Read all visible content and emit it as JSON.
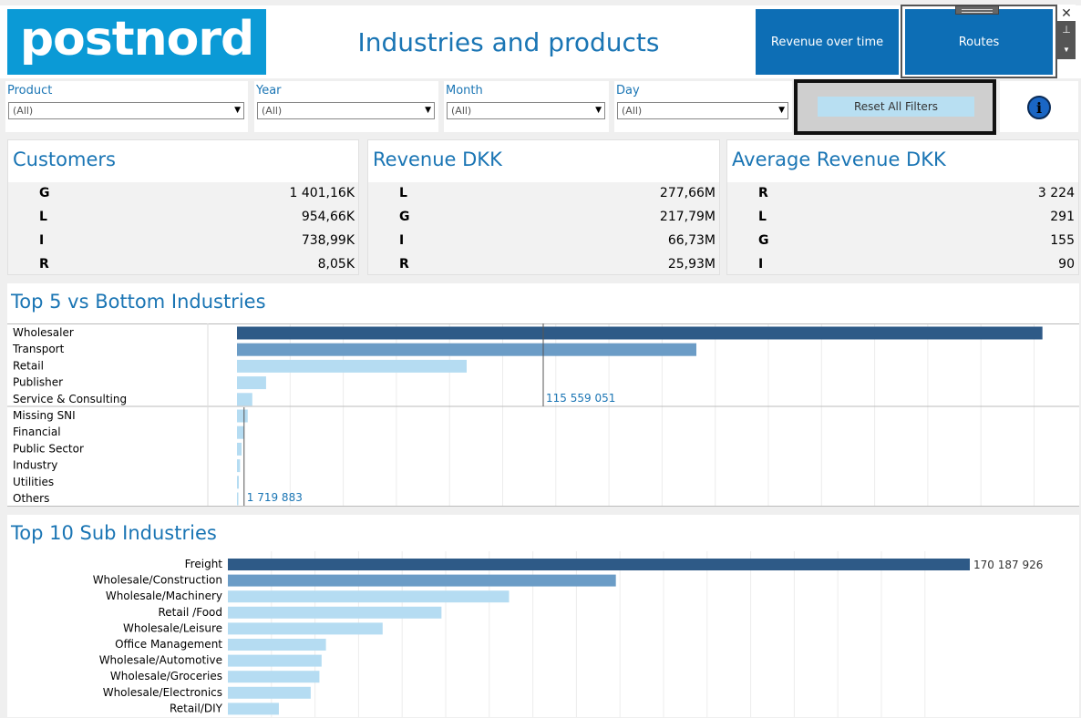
{
  "logo": "postnord",
  "title": "Industries and products",
  "nav": {
    "revenue_over_time": "Revenue over time",
    "routes": "Routes"
  },
  "filters": [
    {
      "label": "Product",
      "value": "(All)"
    },
    {
      "label": "Year",
      "value": "(All)"
    },
    {
      "label": "Month",
      "value": "(All)"
    },
    {
      "label": "Day",
      "value": "(All)"
    }
  ],
  "reset_label": "Reset All Filters",
  "info_glyph": "i",
  "kpis": [
    {
      "title": "Customers",
      "rows": [
        [
          "G",
          "1 401,16K"
        ],
        [
          "L",
          "954,66K"
        ],
        [
          "I",
          "738,99K"
        ],
        [
          "R",
          "8,05K"
        ]
      ]
    },
    {
      "title": "Revenue DKK",
      "rows": [
        [
          "L",
          "277,66M"
        ],
        [
          "G",
          "217,79M"
        ],
        [
          "I",
          "66,73M"
        ],
        [
          "R",
          "25,93M"
        ]
      ]
    },
    {
      "title": "Average Revenue DKK",
      "rows": [
        [
          "R",
          "3 224"
        ],
        [
          "L",
          "291"
        ],
        [
          "G",
          "155"
        ],
        [
          "I",
          "90"
        ]
      ]
    }
  ],
  "colors": {
    "accent": "#1a75b4",
    "bar_dark": "#2e5a87",
    "bar_mid": "#6b9cc6",
    "bar_light": "#b5dcf2"
  },
  "chart_data": [
    {
      "type": "bar",
      "orientation": "horizontal",
      "title": "Top 5 vs Bottom Industries",
      "categories": [
        "Wholesaler",
        "Transport",
        "Retail",
        "Publisher",
        "Service & Consulting",
        "Missing SNI",
        "Financial",
        "Public Sector",
        "Industry",
        "Utilities",
        "Others"
      ],
      "values": [
        263000000,
        150000000,
        75000000,
        9500000,
        5000000,
        3500000,
        2200000,
        1500000,
        1000000,
        600000,
        300000
      ],
      "annotations": [
        "115 559 051",
        "1 719 883"
      ],
      "reference_values": [
        100000000,
        1719883
      ]
    },
    {
      "type": "bar",
      "orientation": "horizontal",
      "title": "Top 10 Sub Industries",
      "categories": [
        "Freight",
        "Wholesale/Construction",
        "Wholesale/Machinery",
        "Retail /Food",
        "Wholesale/Leisure",
        "Office Management",
        "Wholesale/Automotive",
        "Wholesale/Groceries",
        "Wholesale/Electronics",
        "Retail/DIY"
      ],
      "values": [
        170187926,
        89000000,
        64500000,
        49000000,
        35500000,
        22500000,
        21500000,
        21000000,
        19000000,
        11700000
      ],
      "data_labels": [
        "170 187 926"
      ]
    }
  ]
}
